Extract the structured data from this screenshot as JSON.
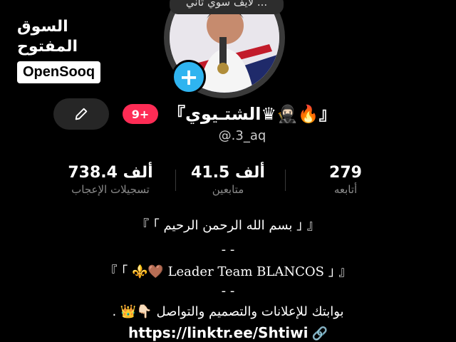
{
  "watermark": {
    "arabic": "السوق المفتوح",
    "latin": "OpenSooq"
  },
  "avatar": {
    "bubble_text": "... لايف سوي ثاني"
  },
  "profile": {
    "badge": "9+",
    "display_name": "『الشتـيوي♛🥷🏻🔥』",
    "handle": "@.3_aq"
  },
  "stats": [
    {
      "value": "738.4",
      "unit": "ألف",
      "label": "تسجيلات الإعجاب"
    },
    {
      "value": "41.5",
      "unit": "ألف",
      "label": "متابعين"
    },
    {
      "value": "279",
      "unit": "",
      "label": "أتابعه"
    }
  ],
  "bio": {
    "line1": "『 ｢ بسم الله الرحمن الرحيم ｣ 』",
    "sep1": "- -",
    "line2": "『 ｢ ⚜️🤎 Leader Team BLANCOS ｣ 』",
    "sep2": "- -",
    "line3": "بوابتك للإعلانات والتصميم والتواصل 👇🏻👑 .",
    "link": "https://linktr.ee/Shtiwi"
  },
  "colors": {
    "accent": "#fe2c55",
    "add_button": "#2fb4f0",
    "background": "#000000"
  },
  "icons": {
    "edit": "pencil-icon",
    "add": "plus-icon",
    "link": "link-icon"
  }
}
